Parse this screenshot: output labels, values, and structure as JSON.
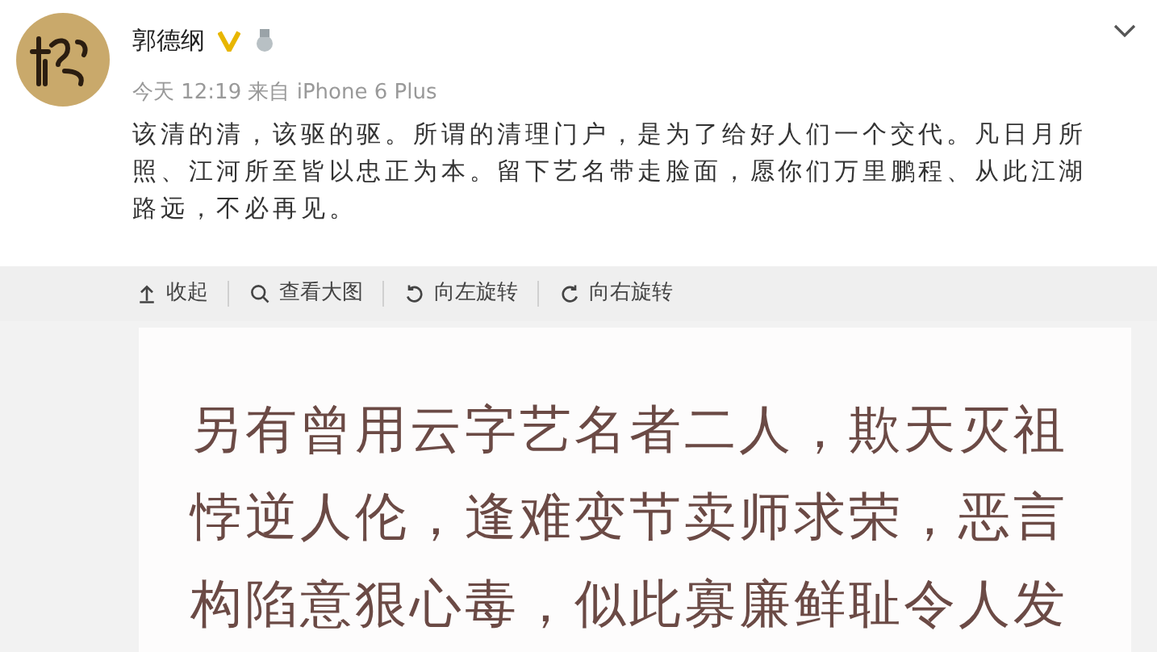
{
  "post": {
    "author": "郭德纲",
    "verified": true,
    "meta": "今天 12:19 来自 iPhone 6 Plus",
    "text": "该清的清，该驱的驱。所谓的清理门户，是为了给好人们一个交代。凡日月所照、江河所至皆以忠正为本。留下艺名带走脸面，愿你们万里鹏程、从此江湖路远，不必再见。"
  },
  "toolbar": [
    {
      "kind": "collapse",
      "label": "收起"
    },
    {
      "kind": "zoom",
      "label": "查看大图"
    },
    {
      "kind": "rotate-left",
      "label": "向左旋转"
    },
    {
      "kind": "rotate-right",
      "label": "向右旋转"
    }
  ],
  "image_text": [
    "另有曾用云字艺名者二人，欺天灭祖",
    "悖逆人伦，逢难变节卖师求荣，恶言",
    "构陷意狠心毒，似此寡廉鲜耻令人发"
  ]
}
